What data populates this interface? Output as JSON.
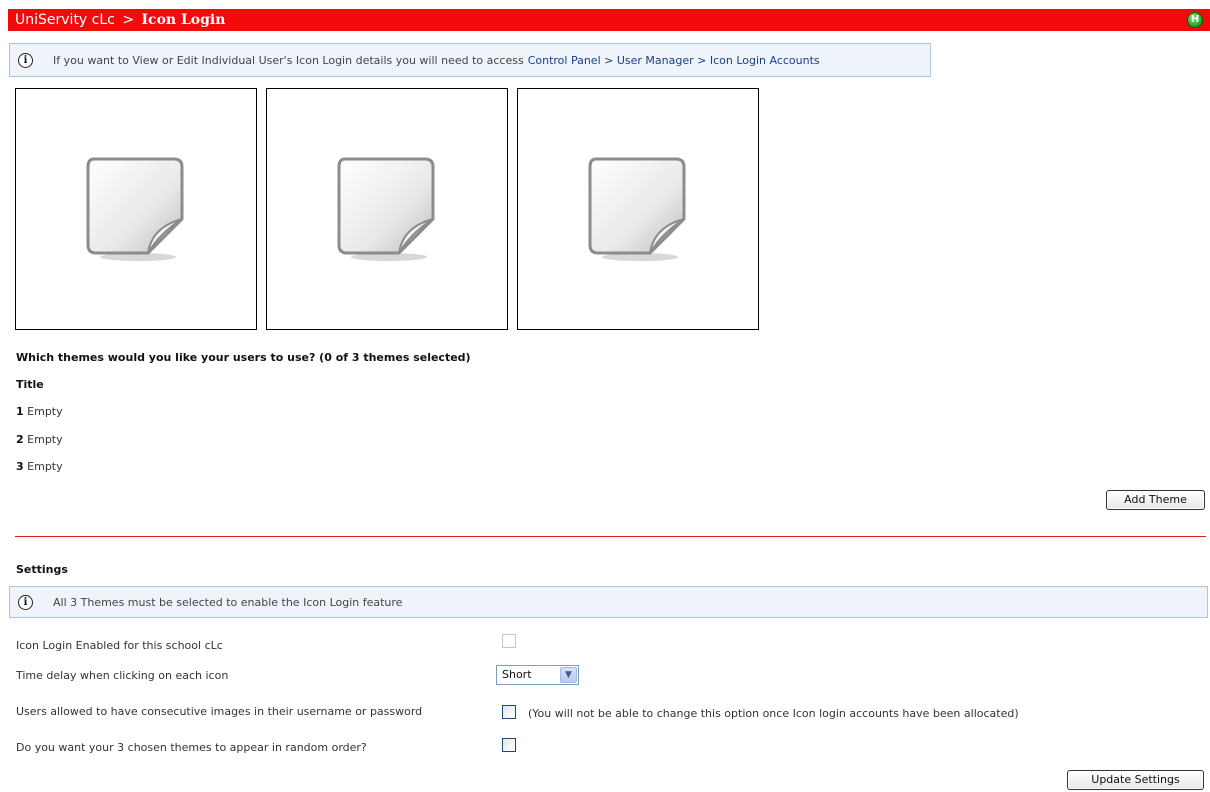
{
  "header": {
    "breadcrumb_root": "UniServity cLc",
    "separator": ">",
    "page_title": "Icon Login",
    "help_icon_letter": "H",
    "bar_color": "#f10b0b"
  },
  "info_banner": {
    "text": "If you want to View or Edit Individual User's Icon Login details you will need to access",
    "link": "Control Panel > User Manager > Icon Login Accounts"
  },
  "themes_section": {
    "question": "Which themes would you like your users to use? (0 of 3 themes selected)",
    "column_header": "Title",
    "slots": [
      {
        "number": "1",
        "title": "Empty"
      },
      {
        "number": "2",
        "title": "Empty"
      },
      {
        "number": "3",
        "title": "Empty"
      }
    ],
    "add_button": "Add Theme",
    "placeholder_icon": "blank-page-icon"
  },
  "settings": {
    "heading": "Settings",
    "info": "All 3 Themes must be selected to enable the Icon Login feature",
    "enabled_label": "Icon Login Enabled for this school cLc",
    "enabled_checked": false,
    "delay_label": "Time delay when clicking on each icon",
    "delay_value": "Short",
    "consecutive_label": "Users allowed to have consecutive images in their username or password",
    "consecutive_checked": false,
    "consecutive_note": "(You will not be able to change this option once Icon login accounts have been allocated)",
    "random_label": "Do you want your 3 chosen themes to appear in random order?",
    "random_checked": false,
    "update_button": "Update Settings"
  }
}
